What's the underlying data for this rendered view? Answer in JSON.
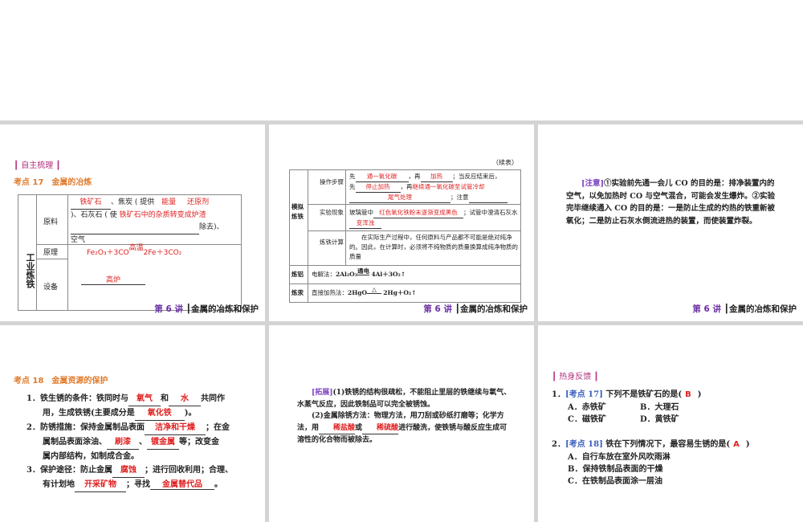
{
  "footer": {
    "num": "第 6 讲",
    "title": "金属的冶炼和保护"
  },
  "s1": {
    "section": "自主梳理",
    "kaodian": "考点 17　金属的冶炼",
    "group": "工业炼铁",
    "row1": "原料",
    "row2": "原理",
    "row3": "设备",
    "t1": "、焦炭 ( 提供",
    "t2": ")、石灰石 ( 使",
    "t3": "除去)、",
    "t4": "空气",
    "a1": "铁矿石",
    "a2": "能量",
    "a3": "还原剂",
    "a4": "铁矿石中的杂质转变成炉渣",
    "eq_l": "Fe₂O₃＋3CO",
    "eq_c": "高温",
    "eq_r": "2Fe＋3CO₂",
    "a5": "高炉"
  },
  "s2": {
    "cont": "（续表）",
    "group": "模拟炼铁",
    "r1": "操作步骤",
    "r2": "实验现象",
    "r3": "炼铁计算",
    "r4": "炼铝",
    "r5": "炼汞",
    "c1a": "先",
    "c1b": "，再",
    "c1c": "；当反应结束后，",
    "c1d": "先",
    "c1e": "，再",
    "c1f": "；注意",
    "a1": "通一氧化碳",
    "a2": "加热",
    "a3": "停止加热",
    "a4": "继续通一氧化碳至试管冷却",
    "a5": "尾气处理",
    "c2a": "玻璃管中",
    "c2b": "；试管中澄清石灰水",
    "a6": "红色氧化铁粉末逐渐变成黑色",
    "a7": "变浑浊",
    "c3": "在实际生产过程中，任何原料与产品都不可能是绝对纯净的。因此，在计算时，必须将不纯物质的质量换算成纯净物质的质量",
    "al_m": "电解法：",
    "al_l": "2Al₂O₃",
    "al_c": "通电",
    "al_r": "4Al＋3O₂↑",
    "hg_m": "直接加热法：",
    "hg_l": "2HgO",
    "hg_c": "△",
    "hg_r": "2Hg＋O₂↑"
  },
  "s3": {
    "tag": "[注意]",
    "text": "①实验前先通一会儿 CO 的目的是：排净装置内的空气，以免加热时 CO 与空气混合，可能会发生爆炸。②实验完毕继续通入 CO 的目的是：一是防止生成的灼热的铁重新被氧化；二是防止石灰水倒流进热的装置，而使装置炸裂。"
  },
  "s4": {
    "kaodian": "考点 18　金属资源的保护",
    "l1a": "1．铁生锈的条件：铁同时与",
    "l1b": "和",
    "l1c": "共同作",
    "l1d": "用，生成铁锈(主要成分是",
    "l1e": ")。",
    "a1": "氧气",
    "a2": "水",
    "a3": "氧化铁",
    "l2a": "2．防锈措施：保持金属制品表面",
    "l2b": "；在金",
    "l2c": "属制品表面涂油、",
    "l2d": "、",
    "l2e": "等；改变金",
    "l2f": "属内部结构，如制成合金。",
    "a4": "洁净和干燥",
    "a5": "刷漆",
    "a6": "镀金属",
    "l3a": "3．保护途径：防止金属",
    "l3b": "；进行回收利用；合理、",
    "l3c": "有计划地",
    "l3d": "；寻找",
    "l3e": "。",
    "a7": "腐蚀",
    "a8": "开采矿物",
    "a9": "金属替代品"
  },
  "s5": {
    "tag": "[拓展]",
    "p1": "(1)铁锈的结构很疏松，不能阻止里层的铁继续与氧气、水蒸气反应，因此铁制品可以完全被锈蚀。",
    "p2a": "(2)金属除锈方法：物理方法，用刀刮或砂纸打磨等；化学方法，用",
    "p2b": "或",
    "p2c": "进行酸洗，使铁锈与酸反应生成可溶性的化合物而被除去。",
    "a1": "稀盐酸",
    "a2": "稀硫酸"
  },
  "s6": {
    "section": "热身反馈",
    "q1": {
      "num": "1．",
      "kp": "[考点 17]",
      "stem": "下列不是铁矿石的是(",
      "ans": "B",
      "close": ")",
      "opts": [
        "A．赤铁矿",
        "B．大理石",
        "C．磁铁矿",
        "D．黄铁矿"
      ]
    },
    "q2": {
      "num": "2．",
      "kp": "[考点 18]",
      "stem": "铁在下列情况下，最容易生锈的是(",
      "ans": "A",
      "close": ")",
      "opts": [
        "A．自行车放在室外风吹雨淋",
        "B．保持铁制品表面的干燥",
        "C．在铁制品表面涂一层油"
      ]
    }
  }
}
